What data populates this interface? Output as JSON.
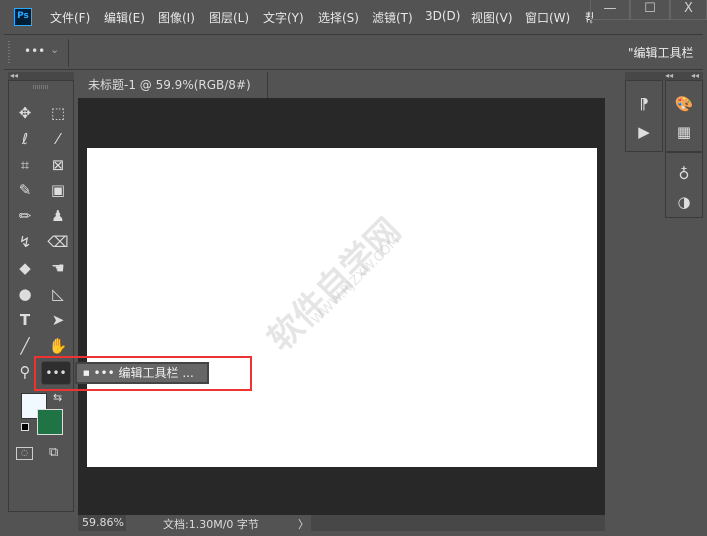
{
  "app": {
    "logo": "Ps"
  },
  "menu": [
    "文件(F)",
    "编辑(E)",
    "图像(I)",
    "图层(L)",
    "文字(Y)",
    "选择(S)",
    "滤镜(T)",
    "3D(D)",
    "视图(V)",
    "窗口(W)",
    "帮"
  ],
  "window_controls": {
    "minimize": "—",
    "maximize": "☐",
    "close": "X"
  },
  "options_bar": {
    "tool_preset": "•••",
    "dropdown": "⌄",
    "right_label": "\"编辑工具栏"
  },
  "document_tab": {
    "title": "未标题-1 @ 59.9%(RGB/8#)",
    "close": "×"
  },
  "flyout": {
    "item": "••• 编辑工具栏 ..."
  },
  "toolbar": {
    "edit_toolbar_button": "•••"
  },
  "colors": {
    "foreground": "#f2f8ff",
    "background": "#207345",
    "highlight": "#ee3333"
  },
  "status": {
    "zoom": "59.86%",
    "doc_info": "文档:1.30M/0 字节",
    "arrow": "〉"
  },
  "watermark": {
    "text": "软件自学网",
    "url": "WWW.RJZXW.COM"
  }
}
